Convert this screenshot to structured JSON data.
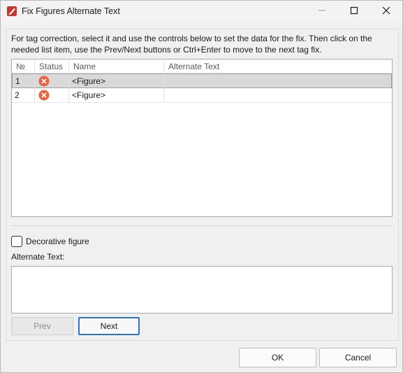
{
  "window": {
    "title": "Fix Figures Alternate Text",
    "controls": {
      "minimize_icon": "minimize-icon",
      "maximize_icon": "maximize-icon",
      "close_icon": "close-icon"
    }
  },
  "instructions": "For tag correction, select it and use the controls below to set the data for the fix. Then click on the needed list item, use the Prev/Next buttons or Ctrl+Enter to move to the next tag fix.",
  "table": {
    "columns": [
      "№",
      "Status",
      "Name",
      "Alternate Text"
    ],
    "rows": [
      {
        "num": "1",
        "status_icon": "error-icon",
        "name": "<Figure>",
        "alt_text": "",
        "selected": true
      },
      {
        "num": "2",
        "status_icon": "error-icon",
        "name": "<Figure>",
        "alt_text": "",
        "selected": false
      }
    ]
  },
  "decorative": {
    "label": "Decorative figure",
    "checked": false
  },
  "alt_text": {
    "label": "Alternate Text:",
    "value": ""
  },
  "buttons": {
    "prev": "Prev",
    "next": "Next",
    "ok": "OK",
    "cancel": "Cancel"
  },
  "colors": {
    "error": "#e8633f",
    "selection": "#d9d9d9",
    "focus_border": "#2f73c9",
    "app_icon": "#c8352b"
  }
}
